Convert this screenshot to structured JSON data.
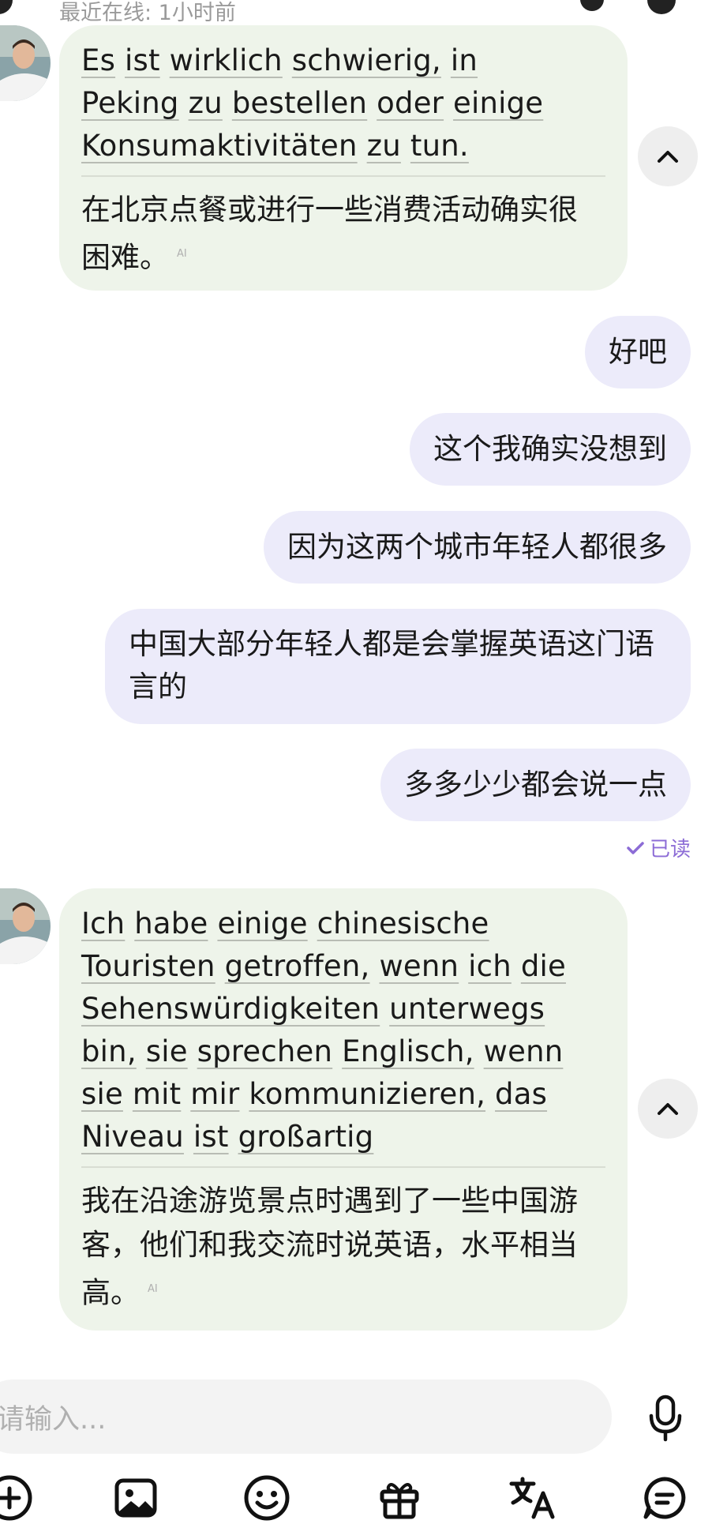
{
  "header": {
    "status": "最近在线: 1小时前"
  },
  "messages": {
    "in1": {
      "original": [
        "Es",
        "ist",
        "wirklich",
        "schwierig,",
        "in",
        "Peking",
        "zu",
        "bestellen",
        "oder",
        "einige",
        "Konsumaktivitäten",
        "zu",
        "tun."
      ],
      "translation": "在北京点餐或进行一些消费活动确实很困难。",
      "ai": "AI"
    },
    "out": [
      "好吧",
      "这个我确实没想到",
      "因为这两个城市年轻人都很多",
      "中国大部分年轻人都是会掌握英语这门语言的",
      "多多少少都会说一点"
    ],
    "read_status": "已读",
    "in2": {
      "original": [
        "Ich",
        "habe",
        "einige",
        "chinesische",
        "Touristen",
        "getroffen,",
        "wenn",
        "ich",
        "die",
        "Sehenswürdigkeiten",
        "unterwegs",
        "bin,",
        "sie",
        "sprechen",
        "Englisch,",
        "wenn",
        "sie",
        "mit",
        "mir",
        "kommunizieren,",
        "das",
        "Niveau",
        "ist",
        "großartig"
      ],
      "translation": "我在沿途游览景点时遇到了一些中国游客，他们和我交流时说英语，水平相当高。",
      "ai": "AI"
    }
  },
  "input": {
    "placeholder": "请输入..."
  },
  "toolbar": [
    "add-icon",
    "image-icon",
    "emoji-icon",
    "gift-icon",
    "translate-icon",
    "chat-icon"
  ],
  "colors": {
    "incoming_bubble": "#eef4ea",
    "outgoing_bubble": "#ecebfa",
    "accent": "#8c6cd6"
  }
}
